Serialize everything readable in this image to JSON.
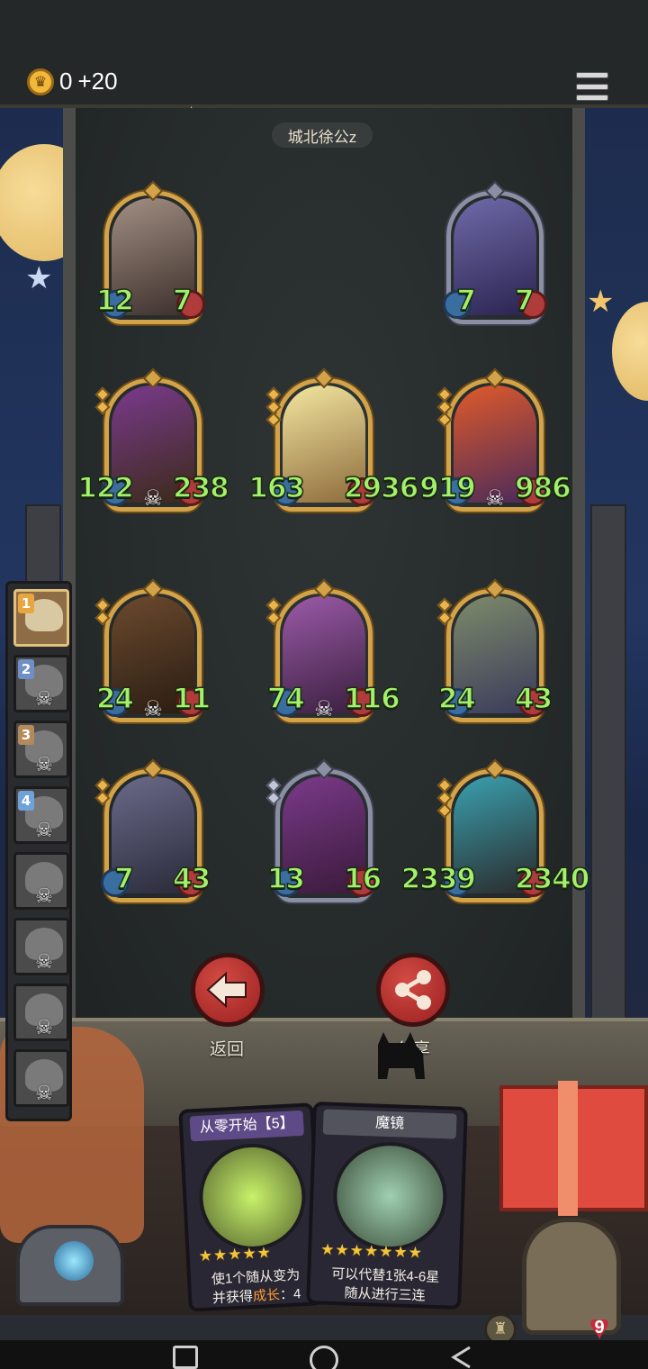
{
  "hud": {
    "coins": "0",
    "coin_gain": "+20",
    "player_name": "城北徐公z"
  },
  "board": {
    "cards": [
      {
        "id": "card-rabbit-rogue",
        "attack": "12",
        "health": "7",
        "pips": 0,
        "frame": "gold",
        "skull": false,
        "art_colors": [
          "#a28f83",
          "#3c2f2b"
        ]
      },
      {
        "id": "card-elf-sorceress",
        "attack": "7",
        "health": "7",
        "pips": 0,
        "frame": "silver",
        "skull": false,
        "art_colors": [
          "#6f6aa8",
          "#2a2350"
        ]
      },
      {
        "id": "card-treant",
        "attack": "122",
        "health": "238",
        "pips": 2,
        "frame": "gold",
        "skull": true,
        "art_colors": [
          "#7a3a8e",
          "#3b2a18"
        ]
      },
      {
        "id": "card-old-warrior",
        "attack": "163",
        "health": "2936",
        "pips": 3,
        "frame": "gold",
        "skull": false,
        "art_colors": [
          "#f3e6a0",
          "#8d6b3b"
        ]
      },
      {
        "id": "card-fire-boar",
        "attack": "919",
        "health": "986",
        "pips": 3,
        "frame": "gold",
        "skull": true,
        "art_colors": [
          "#e05a2a",
          "#4a2a5a"
        ]
      },
      {
        "id": "card-hedgehog-bandit",
        "attack": "24",
        "health": "11",
        "pips": 2,
        "frame": "gold",
        "skull": true,
        "art_colors": [
          "#6b4a2e",
          "#2a1c12"
        ]
      },
      {
        "id": "card-witch",
        "attack": "74",
        "health": "116",
        "pips": 2,
        "frame": "gold",
        "skull": true,
        "art_colors": [
          "#9b5aa8",
          "#3a1f3e"
        ]
      },
      {
        "id": "card-stone-golem",
        "attack": "24",
        "health": "43",
        "pips": 2,
        "frame": "gold",
        "skull": false,
        "art_colors": [
          "#7d8a6a",
          "#3a3a5a"
        ]
      },
      {
        "id": "card-hyena",
        "attack": "7",
        "health": "43",
        "pips": 2,
        "frame": "gold",
        "skull": false,
        "art_colors": [
          "#6a6a8a",
          "#2a2a3a"
        ]
      },
      {
        "id": "card-clown",
        "attack": "13",
        "health": "16",
        "pips": 2,
        "frame": "silver",
        "skull": false,
        "art_colors": [
          "#7a3a8a",
          "#3a1a3a"
        ]
      },
      {
        "id": "card-serpent-king",
        "attack": "2339",
        "health": "2340",
        "pips": 3,
        "frame": "gold",
        "skull": false,
        "art_colors": [
          "#3aa0b0",
          "#2a2a2a"
        ]
      }
    ]
  },
  "lineup": [
    {
      "number": "1",
      "active": true,
      "skull": false
    },
    {
      "number": "2",
      "active": false,
      "skull": true
    },
    {
      "number": "3",
      "active": false,
      "skull": true
    },
    {
      "number": "4",
      "active": false,
      "skull": true
    },
    {
      "number": "",
      "active": false,
      "skull": true
    },
    {
      "number": "",
      "active": false,
      "skull": true
    },
    {
      "number": "",
      "active": false,
      "skull": true
    },
    {
      "number": "",
      "active": false,
      "skull": true
    }
  ],
  "actions": {
    "back_label": "返回",
    "share_label": "分享"
  },
  "hand": {
    "card1": {
      "title": "从零开始【5】",
      "stars": "★★★★★",
      "desc_line1": "使1个随从变为",
      "desc_line2_prefix": "并获得",
      "desc_line2_highlight": "成长",
      "desc_line2_suffix": "：4"
    },
    "card2": {
      "title": "魔镜",
      "stars": "★★★★★★★",
      "desc_line1": "可以代替1张4-6星",
      "desc_line2": "随从进行三连"
    }
  },
  "hero": {
    "health": "9"
  },
  "colors": {
    "stat_green": "#a4f06a",
    "gold_frame": "#d3a34a",
    "silver_frame": "#8a8fa4",
    "button_red": "#c0322f",
    "highlight_orange": "#ff9a2e"
  }
}
